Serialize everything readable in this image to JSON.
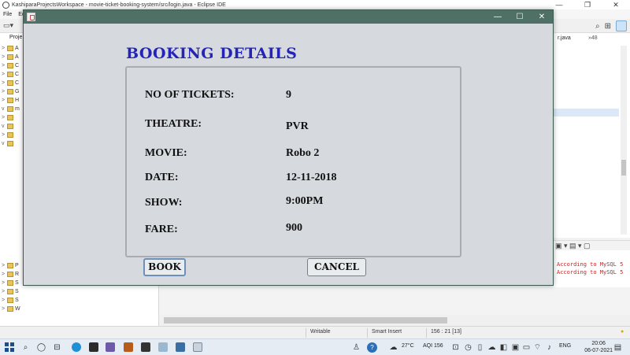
{
  "eclipse": {
    "window_title": "KashiparaProjectsWorkspace - movie-ticket-booking-system/src/login.java - Eclipse IDE",
    "menu": [
      "File",
      "Ed"
    ],
    "win_controls": {
      "minimize": "—",
      "maximize": "❐",
      "close": "✕"
    },
    "project_tab": "Proje",
    "tree_items_upper": [
      {
        "twisty": ">",
        "label": "A"
      },
      {
        "twisty": ">",
        "label": "A"
      },
      {
        "twisty": ">",
        "label": "C"
      },
      {
        "twisty": ">",
        "label": "C"
      },
      {
        "twisty": ">",
        "label": "C"
      },
      {
        "twisty": ">",
        "label": "G"
      },
      {
        "twisty": ">",
        "label": "H"
      },
      {
        "twisty": "v",
        "label": "m"
      },
      {
        "twisty": ">",
        "label": ""
      },
      {
        "twisty": "v",
        "label": ""
      },
      {
        "twisty": ">",
        "label": ""
      },
      {
        "twisty": "v",
        "label": ""
      }
    ],
    "tree_items_lower": [
      {
        "twisty": ">",
        "label": "P"
      },
      {
        "twisty": ">",
        "label": "R"
      },
      {
        "twisty": ">",
        "label": "S"
      },
      {
        "twisty": ">",
        "label": "S"
      },
      {
        "twisty": ">",
        "label": "S"
      },
      {
        "twisty": ">",
        "label": "W"
      }
    ],
    "editor_tab": "r.java",
    "editor_tab_count": "»48",
    "console_lines": [
      "According to MySQL 5",
      "According to MySQL 5"
    ],
    "status": {
      "writable": "Writable",
      "insert_mode": "Smart Insert",
      "position": "156 : 21 [13]"
    }
  },
  "taskbar": {
    "weather": "27°C",
    "aqi": "AQI 156",
    "language": "ENG",
    "time": "20:06",
    "date": "06-07-2021"
  },
  "dialog": {
    "controls": {
      "minimize": "—",
      "maximize": "☐",
      "close": "✕"
    },
    "heading": "BOOKING DETAILS",
    "fields": [
      {
        "label": "NO OF TICKETS:",
        "value": "9"
      },
      {
        "label": "THEATRE:",
        "value": "PVR"
      },
      {
        "label": "MOVIE:",
        "value": "Robo 2"
      },
      {
        "label": "DATE:",
        "value": "12-11-2018"
      },
      {
        "label": "SHOW:",
        "value": "9:00PM"
      },
      {
        "label": "FARE:",
        "value": "900"
      }
    ],
    "book_label": "BOOK",
    "cancel_label": "CANCEL"
  }
}
